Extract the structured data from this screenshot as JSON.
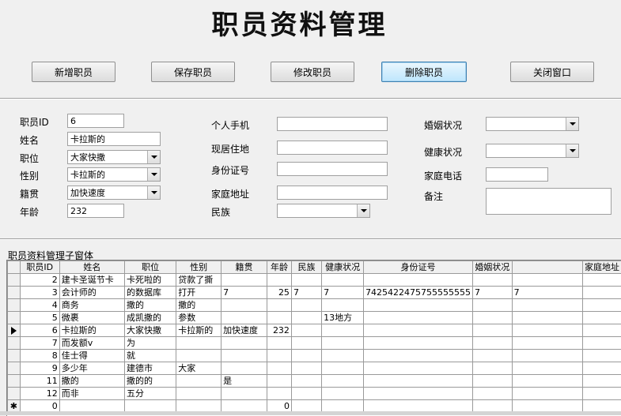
{
  "form": {
    "title": "职员资料管理",
    "buttons": {
      "add": "新增职员",
      "save": "保存职员",
      "edit": "修改职员",
      "delete": "删除职员",
      "close": "关闭窗口"
    }
  },
  "fields": {
    "employee_id": {
      "label": "职员ID",
      "value": "6"
    },
    "name": {
      "label": "姓名",
      "value": "卡拉斯的"
    },
    "position": {
      "label": "职位",
      "value": "大家快撒"
    },
    "gender": {
      "label": "性别",
      "value": "卡拉斯的"
    },
    "origin": {
      "label": "籍贯",
      "value": "加快速度"
    },
    "age": {
      "label": "年龄",
      "value": "232"
    },
    "mobile": {
      "label": "个人手机",
      "value": ""
    },
    "address": {
      "label": "现居住地",
      "value": ""
    },
    "id_card": {
      "label": "身份证号",
      "value": ""
    },
    "home_address": {
      "label": "家庭地址",
      "value": ""
    },
    "ethnicity": {
      "label": "民族",
      "value": ""
    },
    "marital": {
      "label": "婚姻状况",
      "value": ""
    },
    "health": {
      "label": "健康状况",
      "value": ""
    },
    "home_phone": {
      "label": "家庭电话",
      "value": ""
    },
    "notes": {
      "label": "备注",
      "value": ""
    }
  },
  "subform": {
    "caption": "职员资料管理子窗体",
    "columns": [
      "职员ID",
      "姓名",
      "职位",
      "性别",
      "籍贯",
      "年龄",
      "民族",
      "健康状况",
      "身份证号",
      "婚姻状况",
      "",
      "家庭地址"
    ],
    "rows": [
      [
        "2",
        "建卡圣诞节卡",
        "卡死啦的",
        "贷款了撕",
        "",
        "",
        "",
        "",
        "",
        "",
        "",
        ""
      ],
      [
        "3",
        "会计师的",
        "的数据库",
        "打开",
        "7",
        "25",
        "7",
        "7",
        "7425422475755555555",
        "7",
        "7",
        ""
      ],
      [
        "4",
        "商务",
        "撒的",
        "撒的",
        "",
        "",
        "",
        "",
        "",
        "",
        "",
        ""
      ],
      [
        "5",
        "微裹",
        "成凯撒的",
        "参数",
        "",
        "",
        "",
        "13地方",
        "",
        "",
        "",
        ""
      ],
      [
        "6",
        "卡拉斯的",
        "大家快撒",
        "卡拉斯的",
        "加快速度",
        "232",
        "",
        "",
        "",
        "",
        "",
        ""
      ],
      [
        "7",
        "而发额v",
        "为",
        "",
        "",
        "",
        "",
        "",
        "",
        "",
        "",
        ""
      ],
      [
        "8",
        "佳士得",
        "就",
        "",
        "",
        "",
        "",
        "",
        "",
        "",
        "",
        ""
      ],
      [
        "9",
        "多少年",
        "建德市",
        "大家",
        "",
        "",
        "",
        "",
        "",
        "",
        "",
        ""
      ],
      [
        "11",
        "撒的",
        "撒的的",
        "",
        "是",
        "",
        "",
        "",
        "",
        "",
        "",
        ""
      ],
      [
        "12",
        "而非",
        "五分",
        "",
        "",
        "",
        "",
        "",
        "",
        "",
        "",
        ""
      ],
      [
        "0",
        "",
        "",
        "",
        "",
        "0",
        "",
        "",
        "",
        "",
        "",
        ""
      ]
    ],
    "current_row_index": 4,
    "new_row_marker": "✱"
  }
}
